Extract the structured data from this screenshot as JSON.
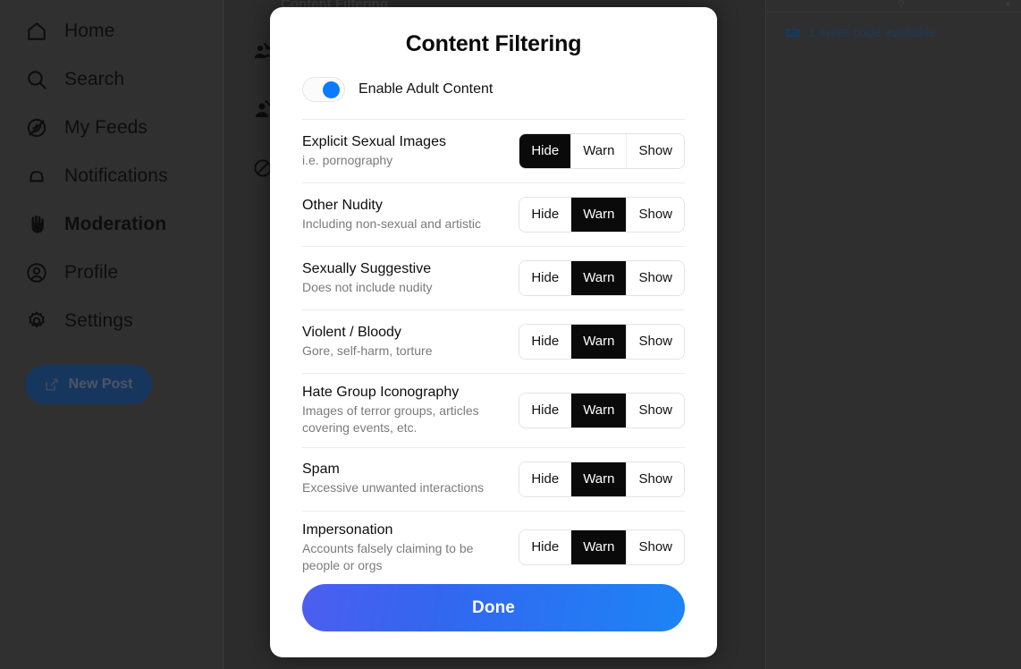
{
  "sidebar": {
    "items": [
      {
        "label": "Home",
        "icon": "home-icon",
        "active": false
      },
      {
        "label": "Search",
        "icon": "search-icon",
        "active": false
      },
      {
        "label": "My Feeds",
        "icon": "feeds-icon",
        "active": false
      },
      {
        "label": "Notifications",
        "icon": "bell-icon",
        "active": false
      },
      {
        "label": "Moderation",
        "icon": "hand-icon",
        "active": true
      },
      {
        "label": "Profile",
        "icon": "person-circle-icon",
        "active": false
      },
      {
        "label": "Settings",
        "icon": "gear-icon",
        "active": false
      }
    ],
    "new_post_label": "New Post"
  },
  "background_page": {
    "title": "Content Filtering",
    "row_icons": [
      "muted-accounts-icon",
      "blocked-account-icon",
      "block-circle-icon"
    ]
  },
  "right_panel": {
    "invite_text": "1 invite code available",
    "invite_icon": "ticket-icon"
  },
  "modal": {
    "title": "Content Filtering",
    "adult_toggle": {
      "label": "Enable Adult Content",
      "enabled": true,
      "accent_color": "#0a7aff"
    },
    "options": [
      "Hide",
      "Warn",
      "Show"
    ],
    "filters": [
      {
        "name": "Explicit Sexual Images",
        "description": "i.e. pornography",
        "selected": "Hide"
      },
      {
        "name": "Other Nudity",
        "description": "Including non-sexual and artistic",
        "selected": "Warn"
      },
      {
        "name": "Sexually Suggestive",
        "description": "Does not include nudity",
        "selected": "Warn"
      },
      {
        "name": "Violent / Bloody",
        "description": "Gore, self-harm, torture",
        "selected": "Warn"
      },
      {
        "name": "Hate Group Iconography",
        "description": "Images of terror groups, articles covering events, etc.",
        "selected": "Warn"
      },
      {
        "name": "Spam",
        "description": "Excessive unwanted interactions",
        "selected": "Warn"
      },
      {
        "name": "Impersonation",
        "description": "Accounts falsely claiming to be people or orgs",
        "selected": "Warn"
      }
    ],
    "done_label": "Done",
    "done_gradient": [
      "#4d5ef0",
      "#1d84f5"
    ]
  }
}
